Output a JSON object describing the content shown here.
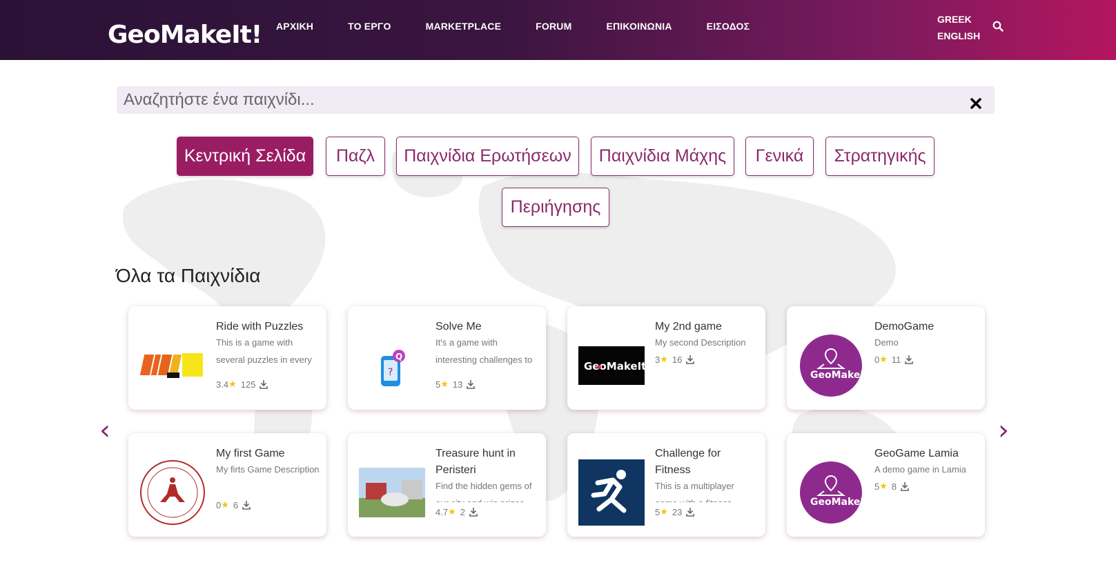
{
  "header": {
    "logo_text": "GeoMakeIt!",
    "nav": [
      "ΑΡΧΙΚΗ",
      "ΤΟ ΕΡΓΟ",
      "MARKETPLACE",
      "FORUM",
      "ΕΠΙΚΟΙΝΩΝΙΑ",
      "ΕΙΣΟΔΟΣ"
    ],
    "languages": [
      "GREEK",
      "ENGLISH"
    ]
  },
  "search": {
    "placeholder": "Αναζητήστε ένα παιχνίδι..."
  },
  "categories": [
    "Κεντρική Σελίδα",
    "Παζλ",
    "Παιχνίδια Ερωτήσεων",
    "Παιχνίδια Μάχης",
    "Γενικά",
    "Στρατηγικής",
    "Περιήγησης"
  ],
  "active_category": "Κεντρική Σελίδα",
  "section_title": "Όλα τα Παιχνίδια",
  "games": [
    {
      "title": "Ride with Puzzles",
      "desc": "This is a game with several puzzles in every location",
      "rating": "3.4",
      "downloads": "125"
    },
    {
      "title": "Solve Me",
      "desc": "It's a game with interesting challenges to solve",
      "rating": "5",
      "downloads": "13"
    },
    {
      "title": "My 2nd game",
      "desc": "My second Description",
      "rating": "3",
      "downloads": "16"
    },
    {
      "title": "DemoGame",
      "desc": "Demo",
      "rating": "0",
      "downloads": "11"
    },
    {
      "title": "My first Game",
      "desc": "My firts Game Description",
      "rating": "0",
      "downloads": "6"
    },
    {
      "title": "Treasure hunt in Peristeri",
      "desc": "Find the hidden gems of our city and win prizes",
      "rating": "4.7",
      "downloads": "2"
    },
    {
      "title": "Challenge for Fitness",
      "desc": "This is a multiplayer game with a fitness",
      "rating": "5",
      "downloads": "23"
    },
    {
      "title": "GeoGame Lamia",
      "desc": "A demo game in Lamia",
      "rating": "5",
      "downloads": "8"
    }
  ],
  "colors": {
    "accent": "#9a1d64",
    "header_start": "#2a1236",
    "header_end": "#b3165f",
    "star": "#f2c40f"
  },
  "icons": {
    "search": "search-icon",
    "clear": "close-icon",
    "download": "download-icon",
    "prev": "chevron-left-icon",
    "next": "chevron-right-icon"
  }
}
